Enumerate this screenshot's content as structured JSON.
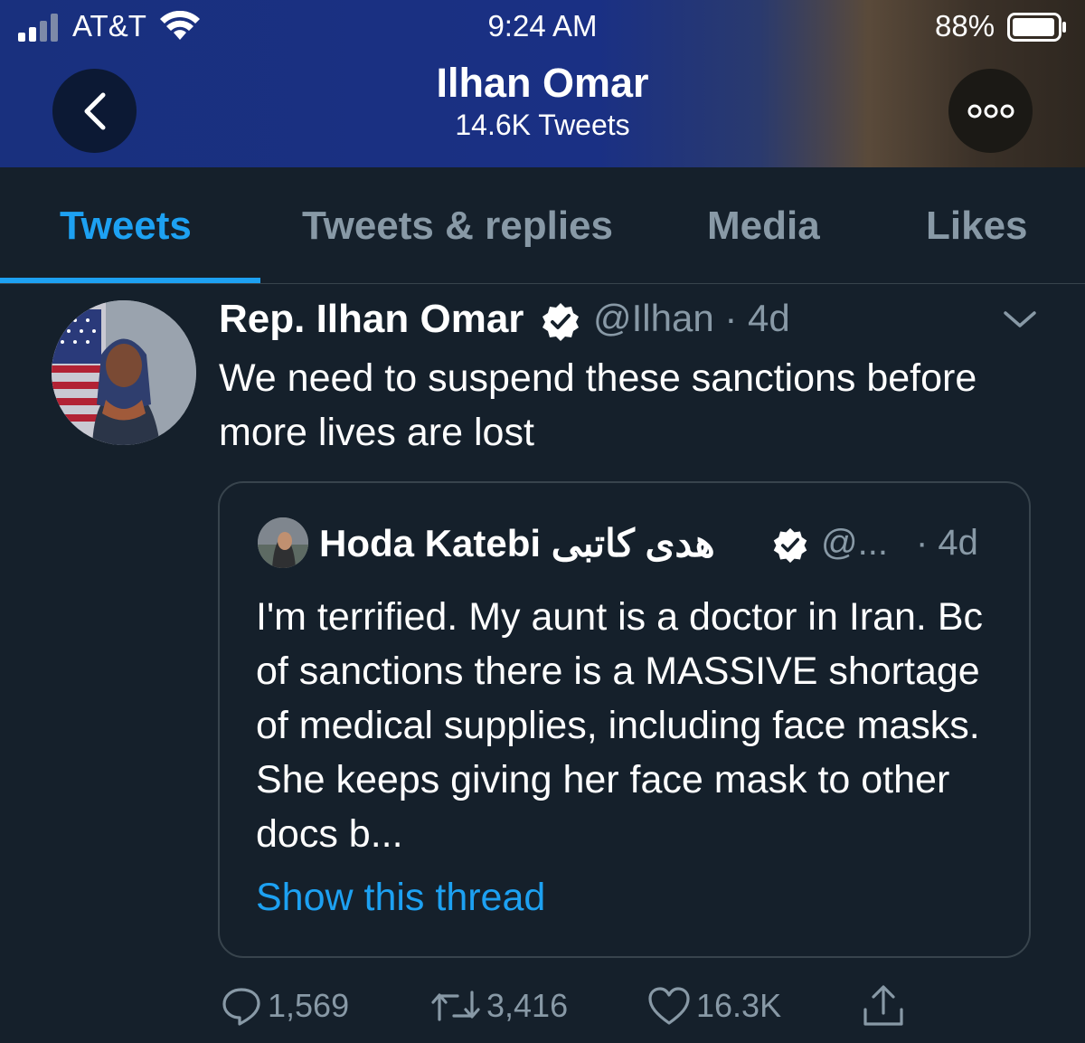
{
  "status_bar": {
    "carrier": "AT&T",
    "time": "9:24 AM",
    "battery_percent": "88%"
  },
  "header": {
    "name": "Ilhan Omar",
    "tweet_count": "14.6K Tweets",
    "back_icon": "chevron-left-icon",
    "more_icon": "more-icon"
  },
  "tabs": [
    {
      "label": "Tweets",
      "active": true
    },
    {
      "label": "Tweets & replies",
      "active": false
    },
    {
      "label": "Media",
      "active": false
    },
    {
      "label": "Likes",
      "active": false
    }
  ],
  "tweet": {
    "display_name": "Rep. Ilhan Omar",
    "handle_time": "@Ilhan · 4d",
    "text": "We need to suspend these sanctions before more lives are lost",
    "quote": {
      "display_name": "Hoda Katebi هدی کاتبی",
      "handle": "@...",
      "time": "· 4d",
      "text": "I'm terrified. My aunt is a doctor in Iran. Bc of sanctions there is a MASSIVE shortage of medical supplies, including face masks. She keeps giving her face mask to other docs b...",
      "show_thread": "Show this thread"
    },
    "actions": {
      "replies": "1,569",
      "retweets": "3,416",
      "likes": "16.3K"
    }
  },
  "colors": {
    "background": "#15202b",
    "accent": "#1da1f2",
    "muted": "#8899a6",
    "border": "#38444d"
  }
}
